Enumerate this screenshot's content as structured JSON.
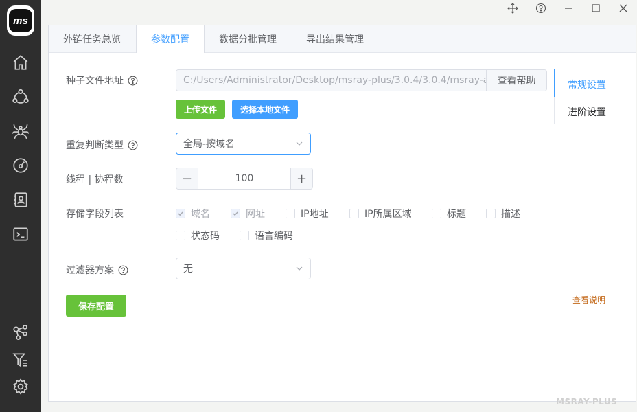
{
  "app": {
    "logo_text": "ms",
    "watermark": "MSRAY-PLUS"
  },
  "sidebar": {
    "items": [
      {
        "icon": "home-icon"
      },
      {
        "icon": "network-icon"
      },
      {
        "icon": "spider-icon"
      },
      {
        "icon": "gauge-icon"
      },
      {
        "icon": "contact-card-icon"
      },
      {
        "icon": "terminal-icon"
      },
      {
        "icon": "share-nodes-icon"
      },
      {
        "icon": "filter-icon"
      },
      {
        "icon": "settings-icon"
      }
    ]
  },
  "tabs": [
    {
      "label": "外链任务总览"
    },
    {
      "label": "参数配置",
      "active": true
    },
    {
      "label": "数据分批管理"
    },
    {
      "label": "导出结果管理"
    }
  ],
  "form": {
    "seed_file": {
      "label": "种子文件地址",
      "value": "C:/Users/Administrator/Desktop/msray-plus/3.0.4/3.0.4/msray-a",
      "help_button": "查看帮助",
      "upload_button": "上传文件",
      "local_button": "选择本地文件"
    },
    "dup_type": {
      "label": "重复判断类型",
      "value": "全局-按域名"
    },
    "threads": {
      "label": "线程 | 协程数",
      "value": "100",
      "minus": "−",
      "plus": "+"
    },
    "fields": {
      "label": "存储字段列表",
      "options": [
        {
          "label": "域名",
          "checked": true,
          "disabled": true
        },
        {
          "label": "网址",
          "checked": true,
          "disabled": true
        },
        {
          "label": "IP地址",
          "checked": false
        },
        {
          "label": "IP所属区域",
          "checked": false
        },
        {
          "label": "标题",
          "checked": false
        },
        {
          "label": "描述",
          "checked": false
        },
        {
          "label": "状态码",
          "checked": false
        },
        {
          "label": "语言编码",
          "checked": false
        }
      ]
    },
    "filter": {
      "label": "过滤器方案",
      "value": "无"
    },
    "save_button": "保存配置",
    "view_notes": "查看说明"
  },
  "settings_nav": {
    "items": [
      {
        "label": "常规设置",
        "active": true
      },
      {
        "label": "进阶设置"
      }
    ]
  },
  "colors": {
    "primary": "#409eff",
    "success": "#67c23a",
    "sidebar_bg": "#2e2e2e",
    "link": "#c46a1b"
  }
}
